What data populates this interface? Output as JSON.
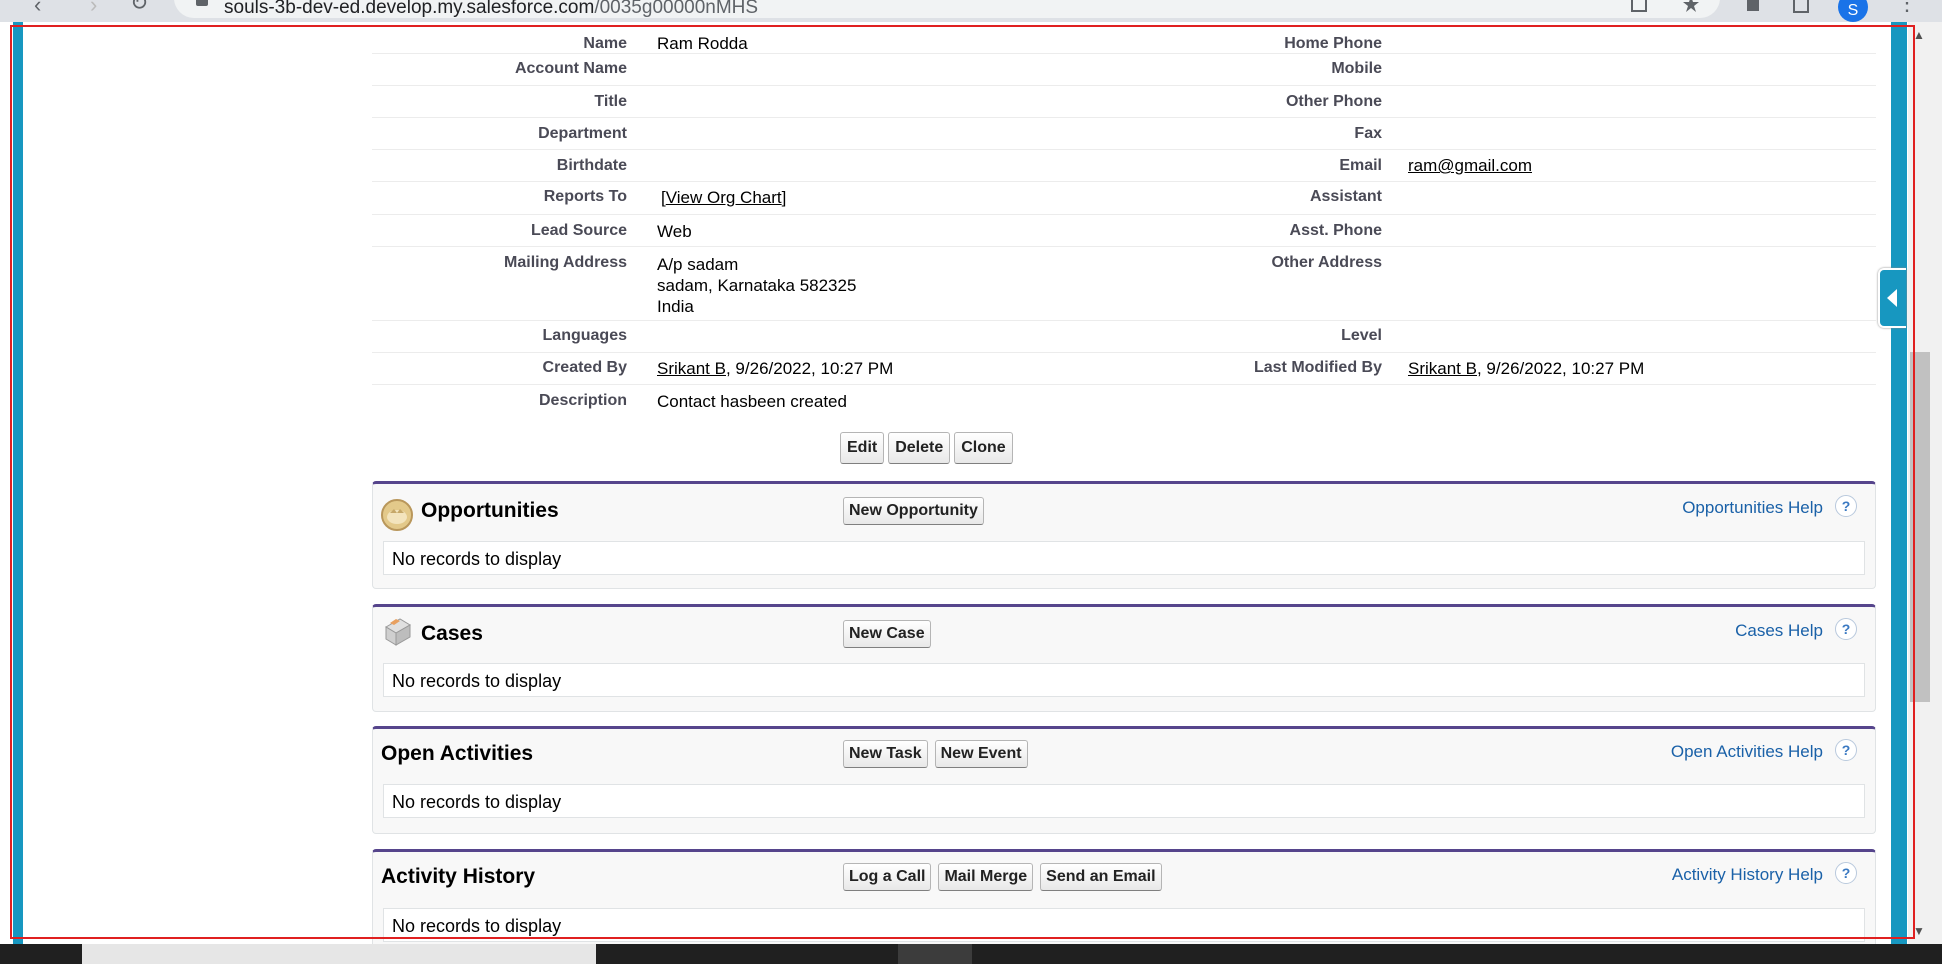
{
  "browser": {
    "url_host": "souls-3b-dev-ed.develop.my.salesforce.com",
    "url_path": "/0035g00000nMHS",
    "profile_initial": "S"
  },
  "details": {
    "rows": [
      {
        "label": "Name",
        "value": "Ram Rodda",
        "label2": "Home Phone",
        "value2": ""
      },
      {
        "label": "Account Name",
        "value": "",
        "label2": "Mobile",
        "value2": ""
      },
      {
        "label": "Title",
        "value": "",
        "label2": "Other Phone",
        "value2": ""
      },
      {
        "label": "Department",
        "value": "",
        "label2": "Fax",
        "value2": ""
      },
      {
        "label": "Birthdate",
        "value": "",
        "label2": "Email",
        "value2": "ram@gmail.com"
      },
      {
        "label": "Reports To",
        "value": "[View Org Chart]",
        "label2": "Assistant",
        "value2": ""
      },
      {
        "label": "Lead Source",
        "value": "Web",
        "label2": "Asst. Phone",
        "value2": ""
      },
      {
        "label": "Mailing Address",
        "value_lines": [
          "A/p sadam",
          "sadam, Karnataka 582325",
          "India"
        ],
        "label2": "Other Address",
        "value2": ""
      },
      {
        "label": "Languages",
        "value": "",
        "label2": "Level",
        "value2": ""
      },
      {
        "label": "Created By",
        "link": "Srikant B",
        "suffix": ", 9/26/2022, 10:27 PM",
        "label2": "Last Modified By",
        "link2": "Srikant B",
        "suffix2": ", 9/26/2022, 10:27 PM"
      },
      {
        "label": "Description",
        "value": "Contact hasbeen created"
      }
    ],
    "view_org_chart": "View Org Chart",
    "buttons": {
      "edit": "Edit",
      "delete": "Delete",
      "clone": "Clone"
    }
  },
  "related_lists": [
    {
      "title": "Opportunities",
      "icon": "opportunity-icon",
      "buttons": [
        "New Opportunity"
      ],
      "help": "Opportunities Help",
      "empty": "No records to display"
    },
    {
      "title": "Cases",
      "icon": "case-icon",
      "buttons": [
        "New Case"
      ],
      "help": "Cases Help",
      "empty": "No records to display"
    },
    {
      "title": "Open Activities",
      "buttons": [
        "New Task",
        "New Event"
      ],
      "help": "Open Activities Help",
      "empty": "No records to display"
    },
    {
      "title": "Activity History",
      "buttons": [
        "Log a Call",
        "Mail Merge",
        "Send an Email"
      ],
      "help": "Activity History Help",
      "empty": "No records to display"
    }
  ],
  "help_glyph": "?",
  "colors": {
    "accent": "#1797c0",
    "related_border": "#56458c",
    "link_help": "#1a61a8",
    "frame": "#e02020"
  }
}
